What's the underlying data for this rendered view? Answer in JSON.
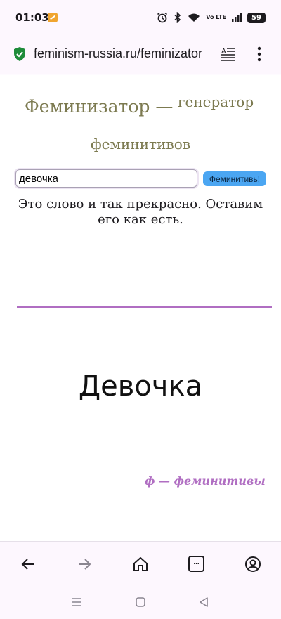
{
  "status_bar": {
    "time": "01:03",
    "battery": "59",
    "network": "Vo LTE"
  },
  "browser": {
    "url": "feminism-russia.ru/feminizator",
    "toolbar_tabs_label": "..."
  },
  "page": {
    "title_main": "Феминизатор —",
    "title_sup": "генератор",
    "title_line2": "феминитивов",
    "input_value": "девочка",
    "button_label": "Феминитивь!",
    "result_message": "Это слово и так прекрасно. Оставим его как есть.",
    "big_word": "Девочка",
    "footer_logo": "ф — феминитивы"
  },
  "colors": {
    "title": "#7c7a50",
    "accent": "#b06ec2",
    "button": "#4ba6f2"
  }
}
